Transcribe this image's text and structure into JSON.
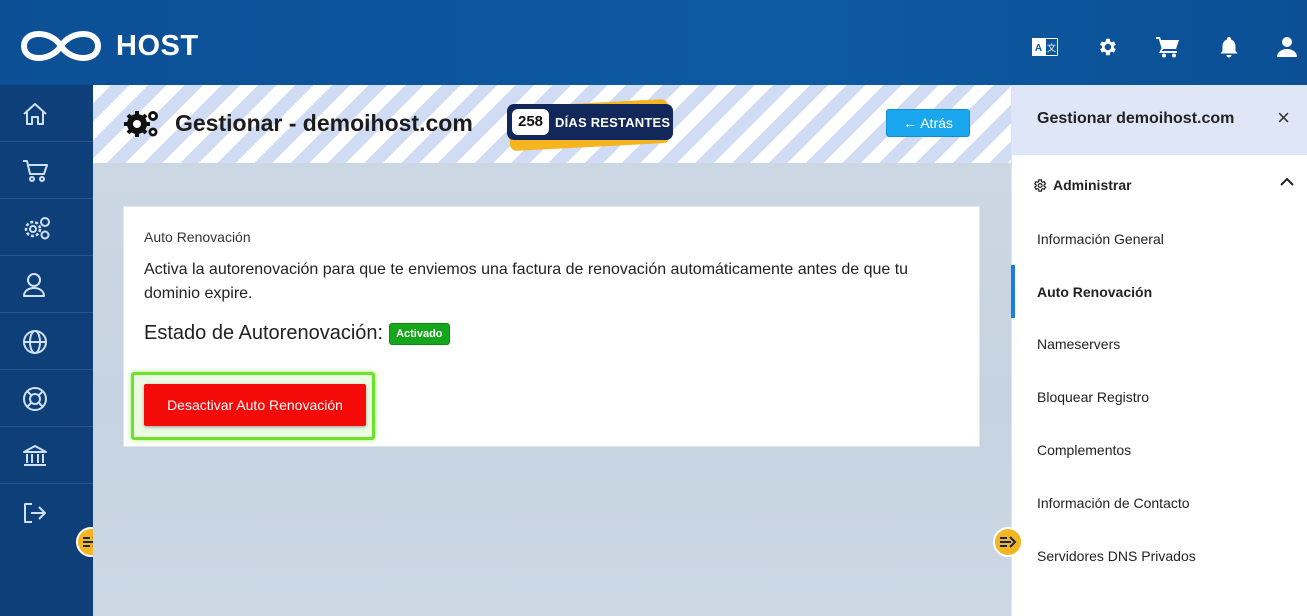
{
  "brand": {
    "name": "HOST"
  },
  "topbar": {
    "icons": [
      "translate-icon",
      "gear-icon",
      "cart-icon",
      "bell-icon",
      "user-icon"
    ]
  },
  "sidebar": {
    "items": [
      {
        "icon": "home-icon"
      },
      {
        "icon": "cart-icon"
      },
      {
        "icon": "gears-icon"
      },
      {
        "icon": "user-icon"
      },
      {
        "icon": "globe-icon"
      },
      {
        "icon": "lifebuoy-icon"
      },
      {
        "icon": "bank-icon"
      },
      {
        "icon": "logout-icon"
      }
    ]
  },
  "header": {
    "title": "Gestionar - demoihost.com",
    "days_remaining": "258",
    "days_label": "DÍAS RESTANTES",
    "back_label": "← Atrás"
  },
  "card": {
    "title": "Auto Renovación",
    "description": "Activa la autorenovación para que te enviemos una factura de renovación automáticamente antes de que tu dominio expire.",
    "status_label": "Estado de Autorenovación:",
    "status_value": "Activado",
    "button_label": "Desactivar Auto Renovación"
  },
  "right_panel": {
    "title": "Gestionar demoihost.com",
    "close": "×",
    "section": "Administrar",
    "items": [
      "Información General",
      "Auto Renovación",
      "Nameservers",
      "Bloquear Registro",
      "Complementos",
      "Información de Contacto",
      "Servidores DNS Privados"
    ],
    "active_item": "Auto Renovación"
  },
  "colors": {
    "topbar": "#0d5aa3",
    "sidebar": "#0f3f78",
    "accent_yellow": "#f5b521",
    "danger": "#f50a0a",
    "success": "#16a61b",
    "info": "#1aa7ef",
    "highlight": "#6fe12b"
  }
}
